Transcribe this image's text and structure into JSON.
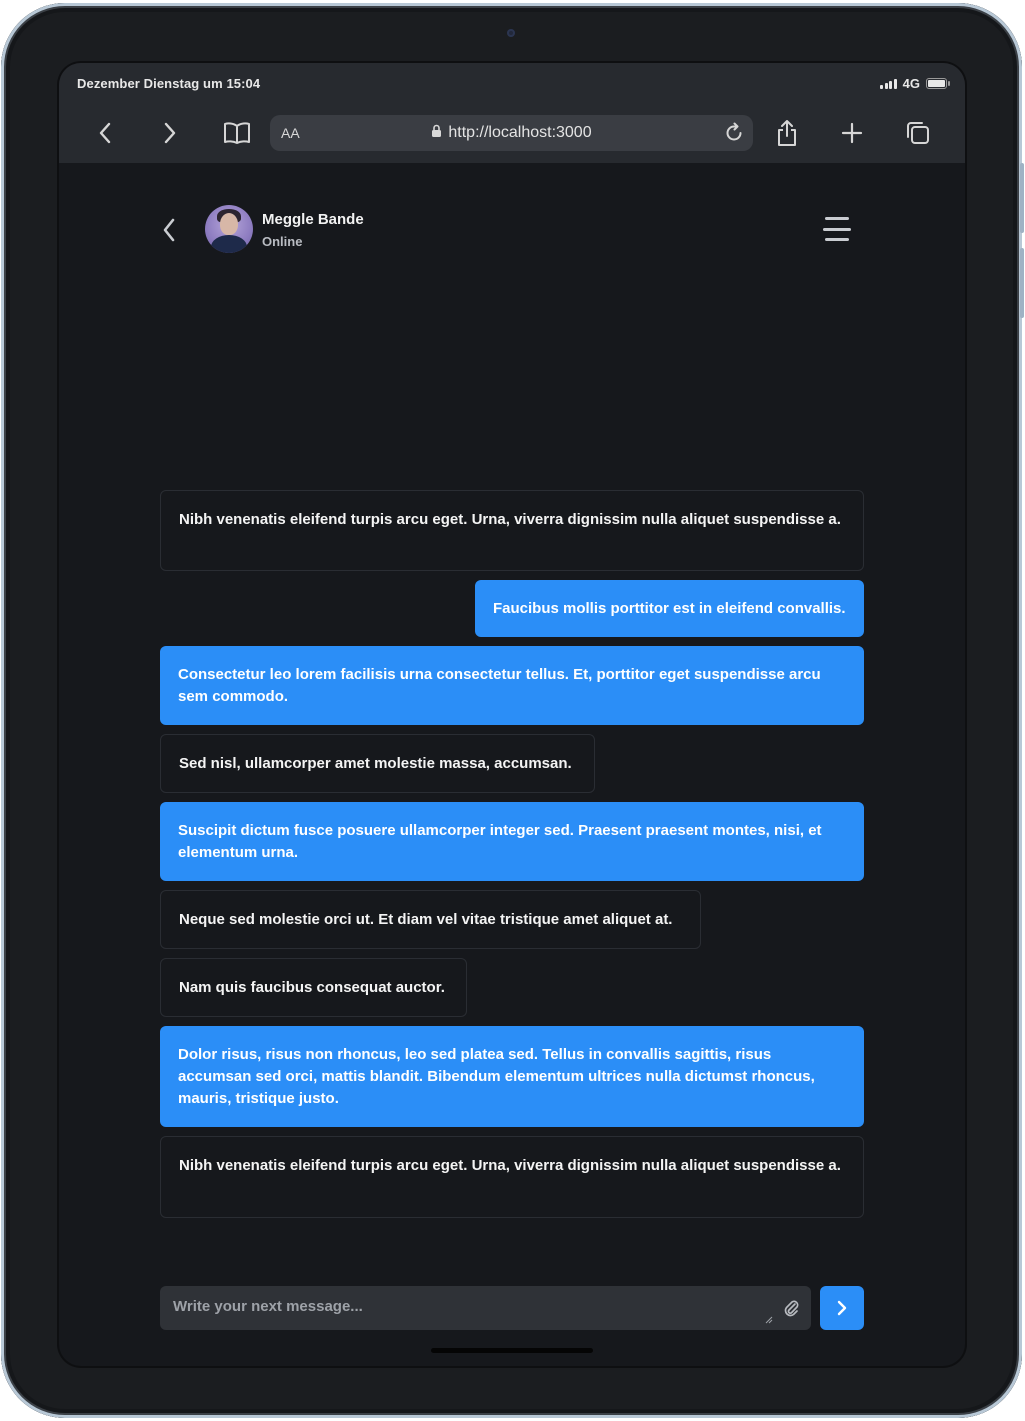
{
  "status_bar": {
    "time": "Dezember Dienstag um 15:04",
    "network": "4G"
  },
  "browser": {
    "aa_label": "AA",
    "url": "http://localhost:3000",
    "icons": [
      "chevron-left-icon",
      "chevron-right-icon",
      "book-icon",
      "lock-icon",
      "reload-icon",
      "share-icon",
      "plus-icon",
      "tabs-icon"
    ]
  },
  "chat": {
    "contact_name": "Meggle Bande",
    "contact_status": "Online",
    "messages": [
      {
        "direction": "incoming",
        "text": "Nibh venenatis eleifend turpis arcu eget. Urna, viverra dignissim nulla aliquet suspendisse a."
      },
      {
        "direction": "outgoing",
        "text": "Faucibus mollis porttitor est in eleifend convallis."
      },
      {
        "direction": "outgoing",
        "text": "Consectetur leo lorem facilisis urna consectetur tellus. Et, porttitor eget suspendisse arcu sem commodo."
      },
      {
        "direction": "incoming",
        "text": "Sed nisl, ullamcorper amet molestie massa, accumsan."
      },
      {
        "direction": "outgoing",
        "text": "Suscipit dictum fusce posuere ullamcorper integer sed. Praesent praesent montes, nisi, et elementum urna."
      },
      {
        "direction": "incoming",
        "text": "Neque sed molestie orci ut. Et diam vel vitae tristique amet aliquet at."
      },
      {
        "direction": "incoming",
        "text": "Nam quis faucibus consequat auctor."
      },
      {
        "direction": "outgoing",
        "text": "Dolor risus, risus non rhoncus, leo sed platea sed. Tellus in convallis sagittis, risus accumsan sed orci, mattis blandit. Bibendum elementum ultrices nulla dictumst rhoncus, mauris, tristique justo."
      },
      {
        "direction": "incoming",
        "text": "Nibh venenatis eleifend turpis arcu eget. Urna, viverra dignissim nulla aliquet suspendisse a."
      }
    ],
    "composer": {
      "placeholder": "Write your next message...",
      "value": ""
    }
  },
  "colors": {
    "accent": "#2b8ef7",
    "background": "#16181c",
    "chrome": "#272a2f"
  }
}
